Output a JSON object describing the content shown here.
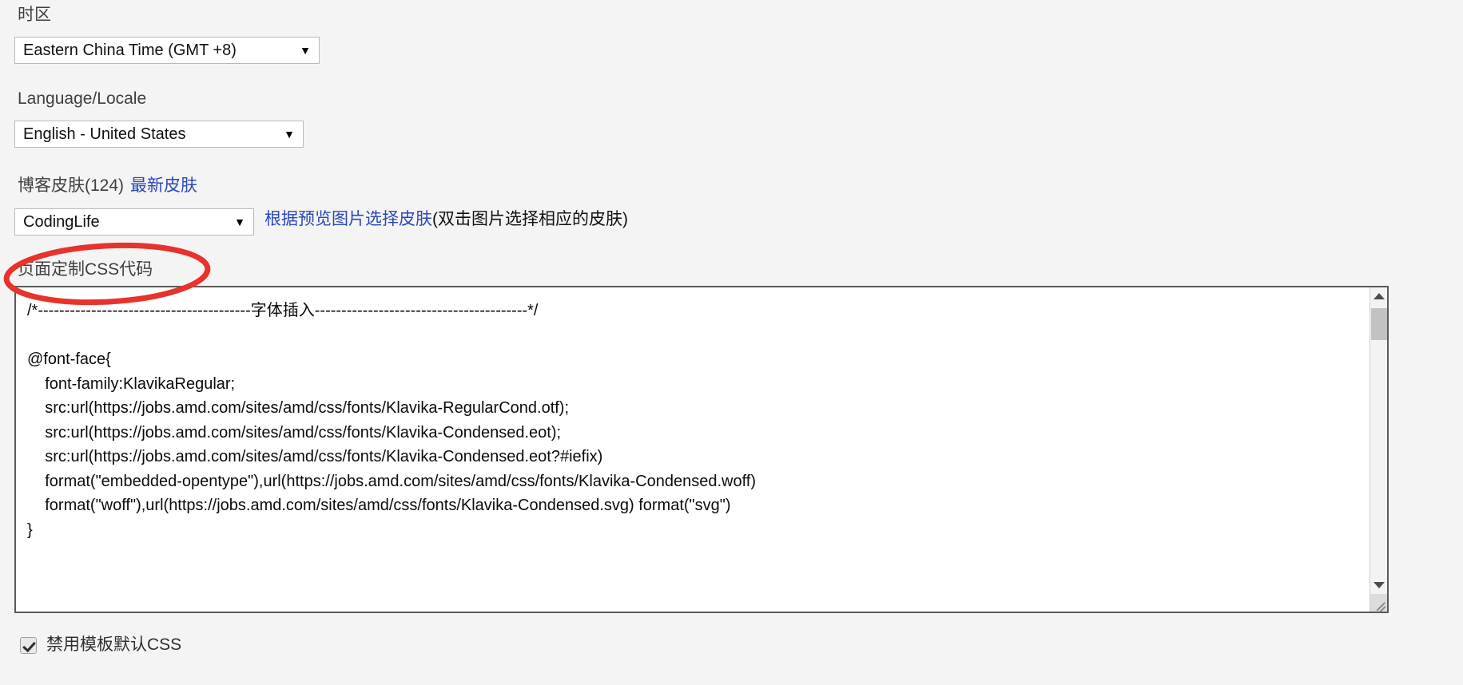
{
  "colors": {
    "page_background": "#f4f4f4",
    "link": "#2b48b8",
    "label": "#3f3f3f",
    "annotation": "#e8322c",
    "textarea_border": "#5a5a5a",
    "scrollbar_thumb": "#c2c2c2"
  },
  "timezone": {
    "label": "时区",
    "selected": "Eastern China Time (GMT +8)",
    "caret": "▼"
  },
  "language": {
    "label": "Language/Locale",
    "selected": "English - United States",
    "caret": "▼"
  },
  "skin": {
    "label": "博客皮肤(124)",
    "latest_link": "最新皮肤",
    "selected": "CodingLife",
    "caret": "▼",
    "hint_link": "根据预览图片选择皮肤",
    "hint_note": "(双击图片选择相应的皮肤)"
  },
  "css_editor": {
    "label": "页面定制CSS代码",
    "content": "/*----------------------------------------字体插入----------------------------------------*/\n\n@font-face{\n    font-family:KlavikaRegular;\n    src:url(https://jobs.amd.com/sites/amd/css/fonts/Klavika-RegularCond.otf);\n    src:url(https://jobs.amd.com/sites/amd/css/fonts/Klavika-Condensed.eot);\n    src:url(https://jobs.amd.com/sites/amd/css/fonts/Klavika-Condensed.eot?#iefix)\n    format(\"embedded-opentype\"),url(https://jobs.amd.com/sites/amd/css/fonts/Klavika-Condensed.woff)\n    format(\"woff\"),url(https://jobs.amd.com/sites/amd/css/fonts/Klavika-Condensed.svg) format(\"svg\")\n}",
    "scrollbar": {
      "up_arrow": "▲",
      "down_arrow": "▼"
    }
  },
  "disable_default_css": {
    "label": "禁用模板默认CSS",
    "checked": true
  }
}
